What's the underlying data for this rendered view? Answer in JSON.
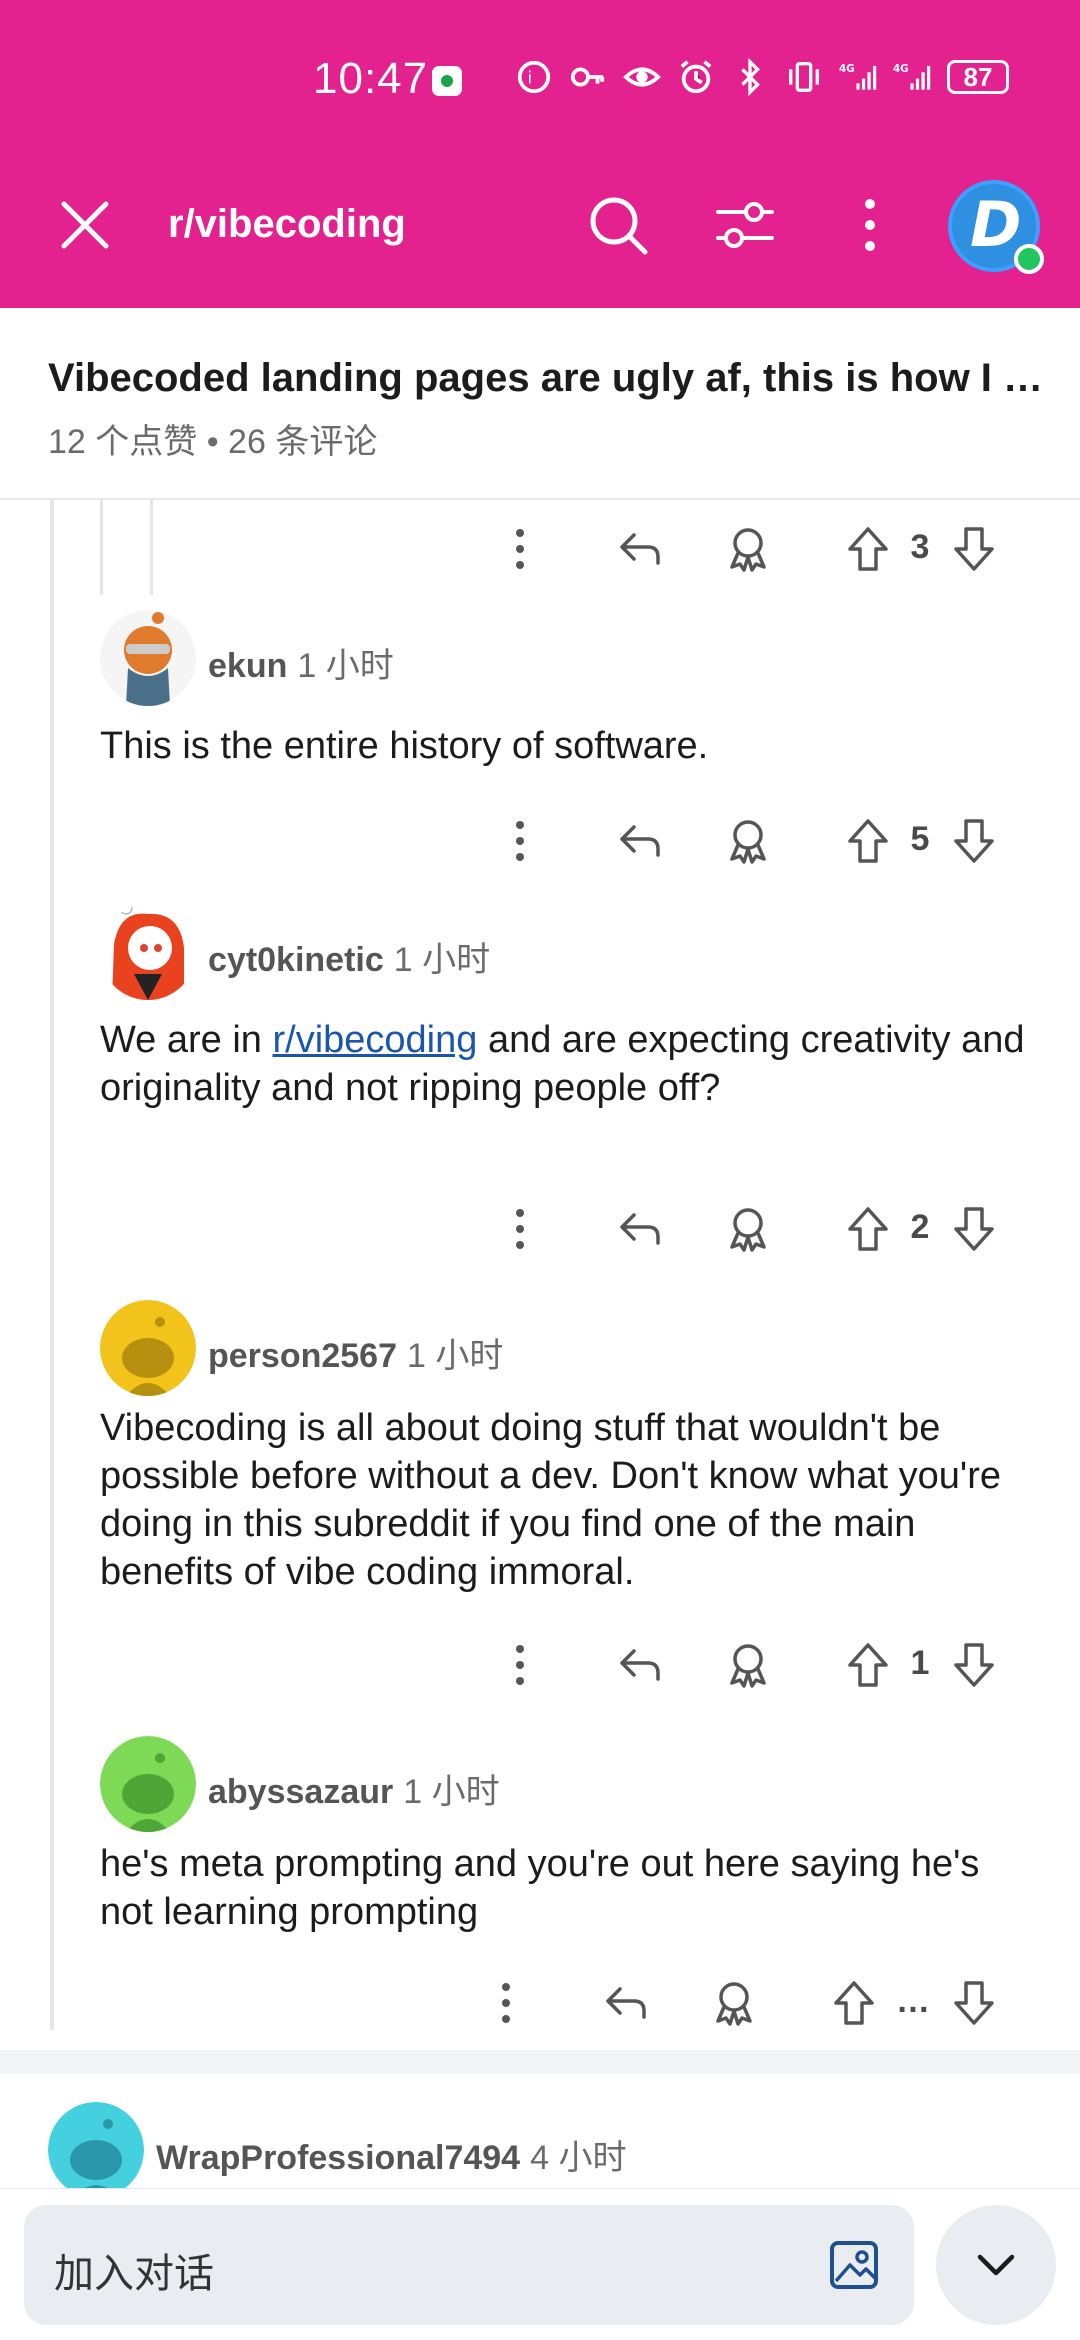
{
  "status": {
    "time": "10:47",
    "battery": "87",
    "net1": "4G",
    "net2": "4G"
  },
  "header": {
    "subreddit": "r/vibecoding",
    "avatar_letter": "D"
  },
  "post": {
    "title": "Vibecoded landing pages are ugly af, this is how I …",
    "meta": "12 个点赞 • 26 条评论"
  },
  "comments": [
    {
      "votes": "3"
    },
    {
      "user": "ekun",
      "time": "1 小时",
      "body": "This is the entire history of software.",
      "votes": "5"
    },
    {
      "user": "cyt0kinetic",
      "time": "1 小时",
      "body_pre": "We are in ",
      "link": "r/vibecoding",
      "body_post": " and are expecting creativity and originality and not ripping people off?",
      "votes": "2"
    },
    {
      "user": "person2567",
      "time": "1 小时",
      "body": "Vibecoding is all about doing stuff that wouldn't be possible before without a dev. Don't know what you're doing in this subreddit if you find one of the main benefits of vibe coding immoral.",
      "votes": "1"
    },
    {
      "user": "abyssazaur",
      "time": "1 小时",
      "body": "he's meta prompting and you're out here saying he's not learning prompting",
      "votes": "…"
    },
    {
      "user": "WrapProfessional7494",
      "time": "4 小时"
    }
  ],
  "bottom": {
    "join_placeholder": "加入对话"
  },
  "colors": {
    "brand": "#e3228f",
    "link": "#1a56b0",
    "online": "#22c55e"
  }
}
